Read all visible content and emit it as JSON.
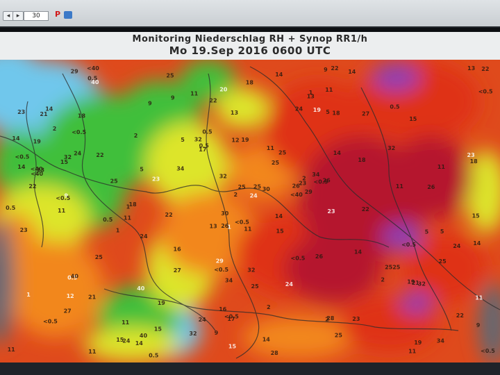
{
  "app": {
    "zoom_value": "30",
    "pdf_icon": "pdf-icon",
    "image_icon": "image-icon"
  },
  "map": {
    "title": "Monitoring Niederschlag RH + Synop RR1/h",
    "timestamp": "Mo 19.Sep 2016 0600 UTC",
    "colors": {
      "no_rain": "#5c6a77",
      "light_blue": "#6fc7ec",
      "green": "#3fbf3a",
      "yellow": "#dde52a",
      "orange": "#f2871f",
      "red": "#df3318",
      "dark_red": "#b5132d",
      "purple": "#8c3fb6"
    },
    "station_values": [
      "0.5",
      "0.5",
      "<0.5",
      "<0.5",
      "1",
      "2",
      "5",
      "9",
      "11",
      "11",
      "12",
      "13",
      "13",
      "14",
      "14",
      "15",
      "15",
      "16",
      "17",
      "18",
      "19",
      "19",
      "20",
      "21",
      "22",
      "22",
      "23",
      "23",
      "24",
      "25",
      "25",
      "26",
      "27",
      "28",
      "29",
      "30",
      "32",
      "34",
      "40",
      "<40"
    ]
  }
}
